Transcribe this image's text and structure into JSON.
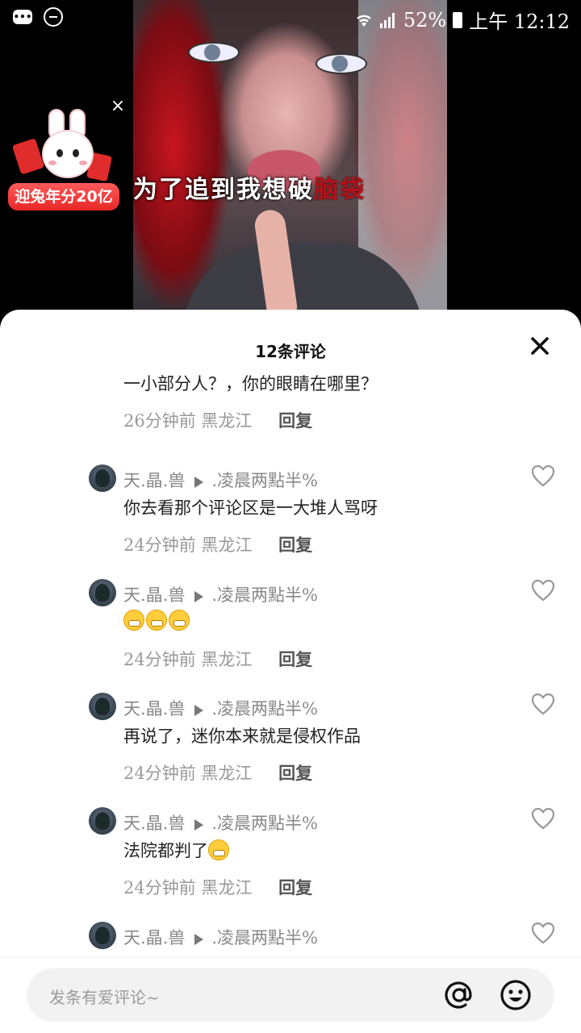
{
  "status_bar": {
    "message_icon": "message-icon",
    "dnd_icon": "do-not-disturb-icon",
    "battery": "52%",
    "time": "上午 12:12"
  },
  "video": {
    "caption_white": "为了追到我想破",
    "caption_red": "脑袋"
  },
  "promo": {
    "label": "迎兔年分20亿",
    "close": "×"
  },
  "comments": {
    "title": "12条评论",
    "items": [
      {
        "user": "",
        "reply_to": "",
        "text": "一小部分人？，你的眼睛在哪里？",
        "time": "26分钟前",
        "location": "黑龙江",
        "reply": "回复"
      },
      {
        "user": "天.晶.兽",
        "reply_to": ".凌晨两點半%",
        "text": "你去看那个评论区是一大堆人骂呀",
        "time": "24分钟前",
        "location": "黑龙江",
        "reply": "回复"
      },
      {
        "user": "天.晶.兽",
        "reply_to": ".凌晨两點半%",
        "text": "",
        "time": "24分钟前",
        "location": "黑龙江",
        "reply": "回复"
      },
      {
        "user": "天.晶.兽",
        "reply_to": ".凌晨两點半%",
        "text": "再说了，迷你本来就是侵权作品",
        "time": "24分钟前",
        "location": "黑龙江",
        "reply": "回复"
      },
      {
        "user": "天.晶.兽",
        "reply_to": ".凌晨两點半%",
        "text": "法院都判了",
        "time": "24分钟前",
        "location": "黑龙江",
        "reply": "回复"
      },
      {
        "user": "天.晶.兽",
        "reply_to": ".凌晨两點半%",
        "text": "",
        "time": "",
        "location": "",
        "reply": ""
      }
    ]
  },
  "input": {
    "placeholder": "发条有爱评论~"
  }
}
